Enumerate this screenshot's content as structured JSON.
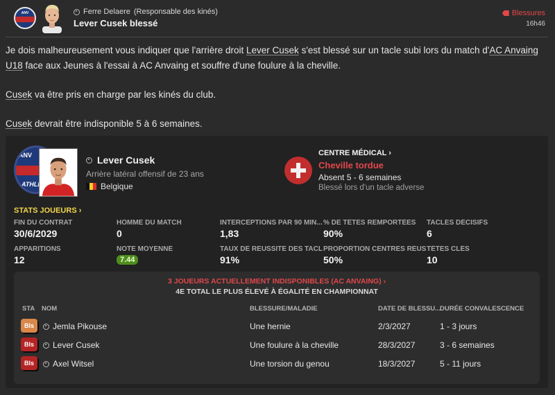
{
  "header": {
    "from_name": "Ferre Delaere",
    "from_role": "(Responsable des kinés)",
    "subject": "Lever Cusek blessé",
    "tag": "Blessures",
    "time": "16h46"
  },
  "message": {
    "p1_prefix": "Je dois malheureusement vous indiquer que l'arrière droit ",
    "p1_player": "Lever Cusek",
    "p1_mid": " s'est blessé sur un tacle subi lors du match d'",
    "p1_club": "AC Anvaing U18",
    "p1_suffix": " face aux Jeunes à l'essai à AC Anvaing et souffre d'une foulure à la cheville.",
    "p2_player": "Cusek",
    "p2_suffix": " va être pris en charge par les kinés du club.",
    "p3_player": "Cusek",
    "p3_suffix": " devrait être indisponible 5 à 6 semaines."
  },
  "player": {
    "name": "Lever Cusek",
    "role": "Arrière latéral offensif de 23 ans",
    "nationality": "Belgique",
    "badge_top": "ANV",
    "badge_bottom": "ATHLET"
  },
  "medical": {
    "title": "CENTRE MÉDICAL",
    "injury": "Cheville tordue",
    "absence": "Absent 5 - 6 semaines",
    "cause": "Blessé lors d'un tacle adverse"
  },
  "stats": {
    "link": "STATS JOUEURS",
    "contract_label": "FIN DU CONTRAT",
    "contract_value": "30/6/2029",
    "motm_label": "HOMME DU MATCH",
    "motm_value": "0",
    "intercept_label": "INTERCEPTIONS PAR 90 MIN...",
    "intercept_value": "1,83",
    "headers_label": "% DE TÊTES REMPORTÉES",
    "headers_value": "90%",
    "tackles_label": "TACLES DÉCISIFS",
    "tackles_value": "6",
    "apps_label": "APPARITIONS",
    "apps_value": "12",
    "rating_label": "NOTE MOYENNE",
    "rating_value": "7.44",
    "tackle_rate_label": "TAUX DE RÉUSSITE DES TACL...",
    "tackle_rate_value": "91%",
    "cross_label": "PROPORTION CENTRES RÉUS...",
    "cross_value": "50%",
    "keyheaders_label": "TÊTES CLÉS",
    "keyheaders_value": "10"
  },
  "injury_list": {
    "title": "3 JOUEURS ACTUELLEMENT INDISPONIBLES (AC ANVAING)",
    "subtitle": "4E TOTAL LE PLUS ÉLEVÉ À ÉGALITÉ EN CHAMPIONNAT",
    "columns": {
      "sta": "STA",
      "nom": "NOM",
      "injury": "BLESSURE/MALADIE",
      "date": "DATE DE BLESSU...",
      "duration": "DURÉE CONVALESCENCE"
    },
    "rows": [
      {
        "status": "Bls",
        "name": "Jemla Pikouse",
        "injury": "Une hernie",
        "date": "2/3/2027",
        "duration": "1 - 3 jours"
      },
      {
        "status": "Bls",
        "name": "Lever Cusek",
        "injury": "Une foulure à la cheville",
        "date": "28/3/2027",
        "duration": "3 - 6 semaines"
      },
      {
        "status": "Bls",
        "name": "Axel Witsel",
        "injury": "Une torsion du genou",
        "date": "18/3/2027",
        "duration": "5 - 11 jours"
      }
    ]
  },
  "colors": {
    "accent_red": "#e2474b",
    "stats_yellow": "#f2d64b",
    "rating_green": "#4f8c1e",
    "status_minor": "#d9874a",
    "status_major": "#b52424"
  }
}
